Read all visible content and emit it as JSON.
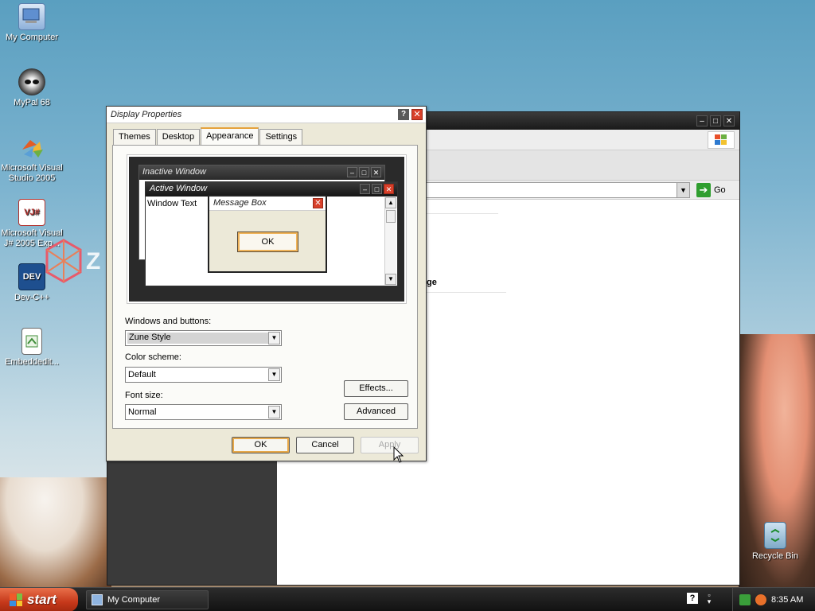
{
  "desktop": {
    "icons": [
      {
        "label": "My Computer"
      },
      {
        "label": "MyPal 68"
      },
      {
        "label": "Microsoft Visual Studio 2005"
      },
      {
        "label": "Microsoft Visual J# 2005 Exp..."
      },
      {
        "label": "Dev-C++"
      },
      {
        "label": "Embeddedit..."
      },
      {
        "label": "Recycle Bin"
      }
    ],
    "zune_letter": "Z"
  },
  "bg_window": {
    "address_go": "Go",
    "header_fragment": "ge"
  },
  "dialog": {
    "title": "Display Properties",
    "help_glyph": "?",
    "close_glyph": "✕",
    "tabs": [
      {
        "label": "Themes",
        "active": false
      },
      {
        "label": "Desktop",
        "active": false
      },
      {
        "label": "Appearance",
        "active": true
      },
      {
        "label": "Settings",
        "active": false
      }
    ],
    "preview": {
      "inactive_title": "Inactive Window",
      "active_title": "Active Window",
      "window_text": "Window Text",
      "msgbox_title": "Message Box",
      "msgbox_ok": "OK"
    },
    "windows_buttons": {
      "label": "Windows and buttons:",
      "value": "Zune Style"
    },
    "color_scheme": {
      "label": "Color scheme:",
      "value": "Default"
    },
    "font_size": {
      "label": "Font size:",
      "value": "Normal"
    },
    "effects_btn": "Effects...",
    "advanced_btn": "Advanced",
    "ok_btn": "OK",
    "cancel_btn": "Cancel",
    "apply_btn": "Apply"
  },
  "taskbar": {
    "start_label": "start",
    "task_item": "My Computer",
    "clock": "8:35 AM",
    "help_glyph": "?"
  },
  "colors": {
    "start": "#c6381a",
    "active_tab_accent": "#e6a23c",
    "close_red": "#d8402a"
  }
}
